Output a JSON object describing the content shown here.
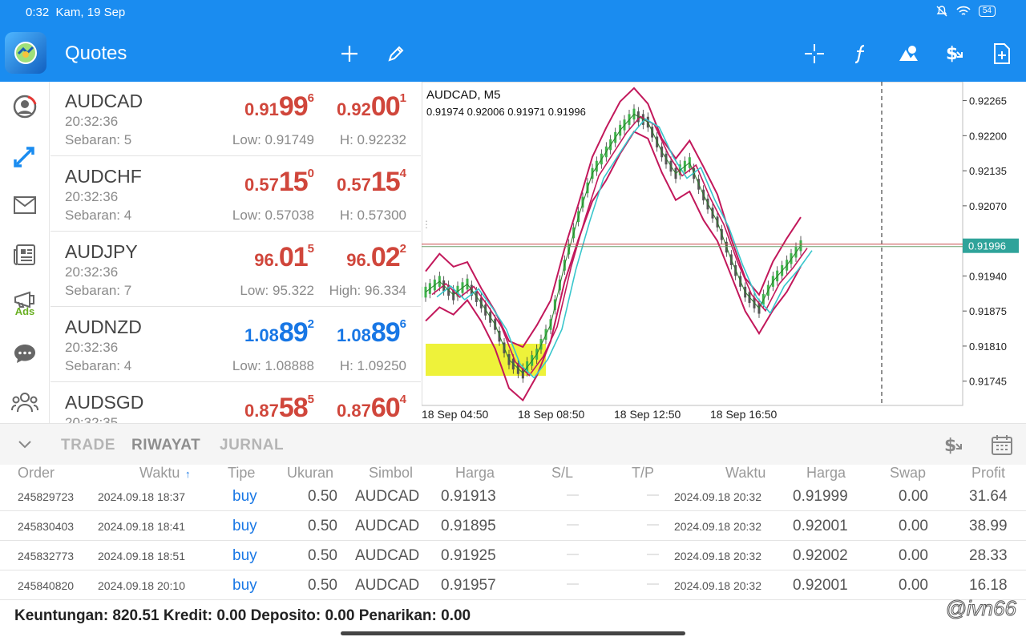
{
  "status": {
    "time": "0:32",
    "date": "Kam, 19 Sep",
    "battery": "54"
  },
  "app": {
    "title": "Quotes"
  },
  "toolbar_icons": [
    "plus-icon",
    "pencil-icon",
    "crosshair-icon",
    "function-icon",
    "objects-icon",
    "dollar-icon",
    "new-file-icon"
  ],
  "sidebar_icons": [
    "account-icon",
    "trade-arrows-icon",
    "mail-icon",
    "news-icon",
    "ads-icon",
    "chat-icon",
    "community-icon"
  ],
  "sidebar_ads_label": "Ads",
  "quotes": [
    {
      "symbol": "AUDCAD",
      "time": "20:32:36",
      "spread": "Sebaran: 5",
      "low": "Low: 0.91749",
      "high": "H: 0.92232",
      "color": "red",
      "bid": {
        "a": "0.91",
        "b": "99",
        "c": "6"
      },
      "ask": {
        "a": "0.92",
        "b": "00",
        "c": "1"
      }
    },
    {
      "symbol": "AUDCHF",
      "time": "20:32:36",
      "spread": "Sebaran: 4",
      "low": "Low: 0.57038",
      "high": "H: 0.57300",
      "color": "red",
      "bid": {
        "a": "0.57",
        "b": "15",
        "c": "0"
      },
      "ask": {
        "a": "0.57",
        "b": "15",
        "c": "4"
      }
    },
    {
      "symbol": "AUDJPY",
      "time": "20:32:36",
      "spread": "Sebaran: 7",
      "low": "Low: 95.322",
      "high": "High: 96.334",
      "color": "red",
      "bid": {
        "a": "96.",
        "b": "01",
        "c": "5"
      },
      "ask": {
        "a": "96.",
        "b": "02",
        "c": "2"
      }
    },
    {
      "symbol": "AUDNZD",
      "time": "20:32:36",
      "spread": "Sebaran: 4",
      "low": "Low: 1.08888",
      "high": "H: 1.09250",
      "color": "blue",
      "bid": {
        "a": "1.08",
        "b": "89",
        "c": "2"
      },
      "ask": {
        "a": "1.08",
        "b": "89",
        "c": "6"
      }
    },
    {
      "symbol": "AUDSGD",
      "time": "20:32:35",
      "spread": "",
      "low": "",
      "high": "",
      "color": "red",
      "bid": {
        "a": "0.87",
        "b": "58",
        "c": "5"
      },
      "ask": {
        "a": "0.87",
        "b": "60",
        "c": "4"
      }
    }
  ],
  "chart": {
    "title": "AUDCAD, M5",
    "ohlc": "0.91974 0.92006 0.91971 0.91996",
    "current_price": "0.91996",
    "y_ticks": [
      "0.92265",
      "0.92200",
      "0.92135",
      "0.92070",
      "0.91940",
      "0.91875",
      "0.91810",
      "0.91745"
    ],
    "x_ticks": [
      "18 Sep 04:50",
      "18 Sep 08:50",
      "18 Sep 12:50",
      "18 Sep 16:50"
    ]
  },
  "chart_data": {
    "type": "line",
    "title": "AUDCAD, M5",
    "xlabel": "",
    "ylabel": "",
    "ylim": [
      0.917,
      0.923
    ],
    "categories": [
      "18 Sep 04:50",
      "18 Sep 08:50",
      "18 Sep 12:50",
      "18 Sep 16:50"
    ],
    "series": [
      {
        "values": [
          0.9191,
          0.9193,
          0.91905,
          0.91925,
          0.9189,
          0.9185,
          0.91785,
          0.9176,
          0.91795,
          0.9185,
          0.9196,
          0.9205,
          0.9213,
          0.9217,
          0.9221,
          0.9224,
          0.92225,
          0.9217,
          0.9213,
          0.9215,
          0.9209,
          0.9204,
          0.9197,
          0.9191,
          0.9188,
          0.9193,
          0.9196,
          0.91996
        ]
      }
    ]
  },
  "tabs": {
    "trade": "TRADE",
    "history": "RIWAYAT",
    "journal": "JURNAL"
  },
  "columns": [
    "Order",
    "Waktu",
    "Tipe",
    "Ukuran",
    "Simbol",
    "Harga",
    "S/L",
    "T/P",
    "Waktu",
    "Harga",
    "Swap",
    "Profit"
  ],
  "sort_arrow": "↑",
  "history": [
    {
      "order": "245829723",
      "open_time": "2024.09.18 18:37",
      "type": "buy",
      "size": "0.50",
      "symbol": "AUDCAD",
      "price": "0.91913",
      "sl": "—",
      "tp": "—",
      "close_time": "2024.09.18 20:32",
      "close_price": "0.91999",
      "swap": "0.00",
      "profit": "31.64"
    },
    {
      "order": "245830403",
      "open_time": "2024.09.18 18:41",
      "type": "buy",
      "size": "0.50",
      "symbol": "AUDCAD",
      "price": "0.91895",
      "sl": "—",
      "tp": "—",
      "close_time": "2024.09.18 20:32",
      "close_price": "0.92001",
      "swap": "0.00",
      "profit": "38.99"
    },
    {
      "order": "245832773",
      "open_time": "2024.09.18 18:51",
      "type": "buy",
      "size": "0.50",
      "symbol": "AUDCAD",
      "price": "0.91925",
      "sl": "—",
      "tp": "—",
      "close_time": "2024.09.18 20:32",
      "close_price": "0.92002",
      "swap": "0.00",
      "profit": "28.33"
    },
    {
      "order": "245840820",
      "open_time": "2024.09.18 20:10",
      "type": "buy",
      "size": "0.50",
      "symbol": "AUDCAD",
      "price": "0.91957",
      "sl": "—",
      "tp": "—",
      "close_time": "2024.09.18 20:32",
      "close_price": "0.92001",
      "swap": "0.00",
      "profit": "16.18"
    }
  ],
  "footer": "Keuntungan: 820.51  Kredit: 0.00  Deposito: 0.00  Penarikan: 0.00",
  "footer_right": "820.51",
  "watermark": "@ivn66",
  "colors": {
    "accent": "#1a8cf0",
    "bid_red": "#d0463b",
    "bid_blue": "#1877e5",
    "band": "#c2185b",
    "ma": "#38c6cc",
    "highlight": "#eef23a"
  }
}
